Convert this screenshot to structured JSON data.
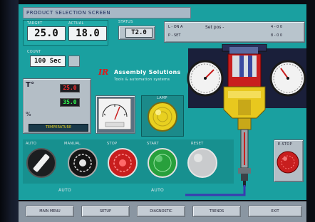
{
  "window": {
    "title": "PRODUCT SELECTION SCREEN"
  },
  "readouts": {
    "target_label": "TARGET",
    "target_value": "25.0",
    "actual_label": "ACTUAL",
    "actual_value": "18.0",
    "status_label": "STATUS",
    "status_value": "T2.0",
    "count_label": "COUNT",
    "count_value": "100 Sec"
  },
  "info_panel": {
    "row1_left": "L  -  ON  A",
    "row1_mid": "Set pos  -",
    "row1_right": "4  -  0  0",
    "row2_left": "P  -  SET",
    "row2_right": "8  -  0  0"
  },
  "temp_panel": {
    "label_top": "T°",
    "label_bottom": "%",
    "led_top": "25.0",
    "led_bottom": "35.0",
    "caption": "TEMPERATURE"
  },
  "logo": {
    "brand": "Assembly Solutions",
    "tagline": "Tools & automation systems"
  },
  "knob_labels": [
    "AUTO",
    "MANUAL",
    "STOP",
    "START",
    "RESET"
  ],
  "mode_labels": [
    "AUTO",
    "AUTO"
  ],
  "panel_labels": {
    "meter": "",
    "yellow_lamp": "LAMP",
    "estop": "E-STOP"
  },
  "bottom_buttons": [
    "MAIN MENU",
    "SETUP",
    "DIAGNOSTIC",
    "TRENDS",
    "EXIT"
  ],
  "colors": {
    "panel": "#1aa0a0",
    "yellow": "#e8d020",
    "red": "#c81e1e",
    "green": "#28a03c"
  }
}
